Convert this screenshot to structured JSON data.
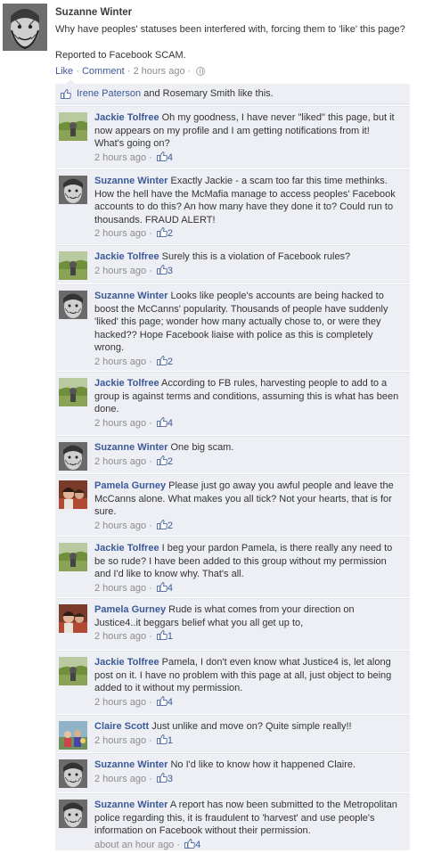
{
  "post": {
    "author": "Suzanne Winter",
    "line1": "Why have peoples' statuses been interfered with, forcing them to 'like' this page?",
    "line2": "Reported to Facebook SCAM.",
    "action_like": "Like",
    "action_comment": "Comment",
    "time": "2 hours ago",
    "sep": "·"
  },
  "likes": {
    "name1": "Irene Paterson",
    "connector": "and",
    "name2": "Rosemary Smith",
    "suffix": "like this."
  },
  "colors": {
    "link": "#3b5998",
    "feedback_bg": "#edeff4",
    "meta": "#8c8c8c"
  },
  "comments": [
    {
      "author": "Jackie Tolfree",
      "avatar": "landscape",
      "text": "Oh my goodness, I have never \"liked\" this page, but it now appears on my profile and I am getting notifications from it! What's going on?",
      "time": "2 hours ago",
      "likes": "4"
    },
    {
      "author": "Suzanne Winter",
      "avatar": "face",
      "text": "Exactly Jackie - a scam too far this time methinks. How the hell have the McMafia manage to access peoples' Facebook accounts to do this? An how many have they done it to? Could run to thousands. FRAUD ALERT!",
      "time": "2 hours ago",
      "likes": "2"
    },
    {
      "author": "Jackie Tolfree",
      "avatar": "landscape",
      "text": "Surely this is a violation of Facebook rules?",
      "time": "2 hours ago",
      "likes": "3"
    },
    {
      "author": "Suzanne Winter",
      "avatar": "face",
      "text": "Looks like people's accounts are being hacked to boost the McCanns' popularity. Thousands of people have suddenly 'liked' this page; wonder how many actually chose to, or were they hacked?? Hope Facebook liaise with police as this is completely wrong.",
      "time": "2 hours ago",
      "likes": "2"
    },
    {
      "author": "Jackie Tolfree",
      "avatar": "landscape",
      "text": "According to FB rules, harvesting people to add to a group is against terms and conditions, assuming this is what has been done.",
      "time": "2 hours ago",
      "likes": "4"
    },
    {
      "author": "Suzanne Winter",
      "avatar": "face",
      "text": "One big scam.",
      "time": "2 hours ago",
      "likes": "2"
    },
    {
      "author": "Pamela Gurney",
      "avatar": "pamela",
      "text": "Please just go away you awful people and leave the McCanns alone. What makes you all tick? Not your hearts, that is for sure.",
      "time": "2 hours ago",
      "likes": "2"
    },
    {
      "author": "Jackie Tolfree",
      "avatar": "landscape",
      "text": "I beg your pardon Pamela, is there really any need to be so rude? I have been added to this group without my permission and I'd like to know why. That's all.",
      "time": "2 hours ago",
      "likes": "4"
    },
    {
      "author": "Pamela Gurney",
      "avatar": "pamela",
      "text": "Rude is what comes from your direction on Justice4..it beggars belief what you all get up to,",
      "time": "2 hours ago",
      "likes": "1"
    },
    {
      "author": "Jackie Tolfree",
      "avatar": "landscape",
      "text": "Pamela, I don't even know what Justice4 is, let along post on it. I have no problem with this page at all, just object to being added to it without my permission.",
      "time": "2 hours ago",
      "likes": "4"
    },
    {
      "author": "Claire Scott",
      "avatar": "claire",
      "text": "Just unlike and move on? Quite simple really!!",
      "time": "2 hours ago",
      "likes": "1"
    },
    {
      "author": "Suzanne Winter",
      "avatar": "face",
      "text": "No I'd like to know how it happened Claire.",
      "time": "2 hours ago",
      "likes": "3"
    },
    {
      "author": "Suzanne Winter",
      "avatar": "face",
      "text": "A report has now been submitted to the Metropolitan police regarding this, it is fraudulent to 'harvest' and use people's information on Facebook without their permission.",
      "time": "about an hour ago",
      "likes": "4"
    }
  ]
}
